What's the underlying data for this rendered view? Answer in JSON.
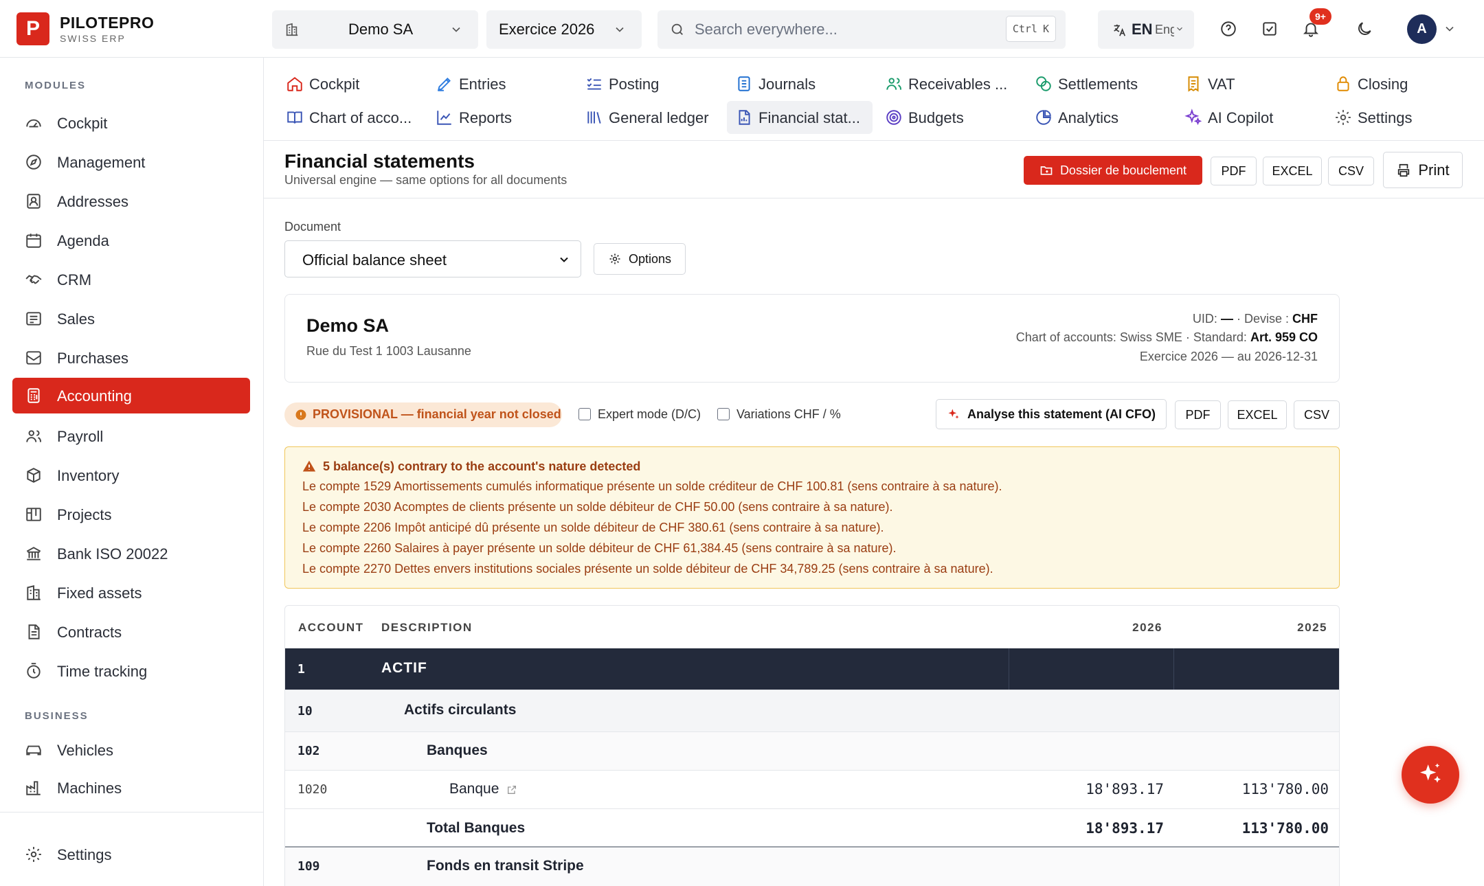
{
  "brand": {
    "logo_letter": "P",
    "name": "PILOTEPRO",
    "subtitle": "SWISS ERP",
    "color": "#d9281c"
  },
  "topbar": {
    "company": "Demo SA",
    "fiscal_year": "Exercice 2026",
    "search_placeholder": "Search everywhere...",
    "shortcut_key1": "Ctrl",
    "shortcut_key2": "K",
    "language_code": "EN",
    "language_name": "Eng",
    "notifications_badge": "9+",
    "avatar_initial": "A"
  },
  "sidebar": {
    "modules_title": "MODULES",
    "modules": [
      {
        "label": "Cockpit",
        "icon": "gauge-icon"
      },
      {
        "label": "Management",
        "icon": "compass-icon"
      },
      {
        "label": "Addresses",
        "icon": "contact-book-icon"
      },
      {
        "label": "Agenda",
        "icon": "calendar-icon"
      },
      {
        "label": "CRM",
        "icon": "handshake-icon"
      },
      {
        "label": "Sales",
        "icon": "receipt-icon"
      },
      {
        "label": "Purchases",
        "icon": "inbox-icon"
      },
      {
        "label": "Accounting",
        "icon": "calculator-icon",
        "active": true
      },
      {
        "label": "Payroll",
        "icon": "users-icon"
      },
      {
        "label": "Inventory",
        "icon": "box-icon"
      },
      {
        "label": "Projects",
        "icon": "kanban-icon"
      },
      {
        "label": "Bank ISO 20022",
        "icon": "bank-icon"
      },
      {
        "label": "Fixed assets",
        "icon": "building-icon"
      },
      {
        "label": "Contracts",
        "icon": "document-icon"
      },
      {
        "label": "Time tracking",
        "icon": "stopwatch-icon"
      }
    ],
    "business_title": "BUSINESS",
    "business": [
      {
        "label": "Vehicles",
        "icon": "car-icon"
      },
      {
        "label": "Machines",
        "icon": "factory-icon"
      }
    ],
    "settings_label": "Settings"
  },
  "modules_nav": [
    {
      "label": "Cockpit",
      "icon": "home-icon"
    },
    {
      "label": "Entries",
      "icon": "pencil-icon"
    },
    {
      "label": "Posting",
      "icon": "list-check-icon"
    },
    {
      "label": "Journals",
      "icon": "book-list-icon"
    },
    {
      "label": "Receivables ...",
      "icon": "users-icon"
    },
    {
      "label": "Settlements",
      "icon": "coins-icon"
    },
    {
      "label": "VAT",
      "icon": "receipt-icon"
    },
    {
      "label": "Closing",
      "icon": "lock-icon"
    },
    {
      "label": "Chart of acco...",
      "icon": "open-book-icon"
    },
    {
      "label": "Reports",
      "icon": "line-chart-icon"
    },
    {
      "label": "General ledger",
      "icon": "library-icon"
    },
    {
      "label": "Financial stat...",
      "icon": "file-chart-icon",
      "active": true
    },
    {
      "label": "Budgets",
      "icon": "target-icon"
    },
    {
      "label": "Analytics",
      "icon": "pie-icon"
    },
    {
      "label": "AI Copilot",
      "icon": "sparkles-icon"
    },
    {
      "label": "Settings",
      "icon": "gear-icon"
    }
  ],
  "page": {
    "title": "Financial statements",
    "subtitle": "Universal engine — same options for all documents",
    "dossier_button": "Dossier de bouclement",
    "pdf": "PDF",
    "excel": "EXCEL",
    "csv": "CSV",
    "print": "Print"
  },
  "document": {
    "label": "Document",
    "selected": "Official balance sheet",
    "options_button": "Options"
  },
  "company_card": {
    "name": "Demo SA",
    "address": "Rue du Test 1 1003 Lausanne",
    "uid_label": "UID:",
    "uid_value": "—",
    "currency_label": "· Devise :",
    "currency_value": "CHF",
    "chart_label": "Chart of accounts: Swiss SME · Standard:",
    "standard_value": "Art. 959 CO",
    "period": "Exercice 2026 — au 2026-12-31"
  },
  "toolbar": {
    "provisional": "PROVISIONAL — financial year not closed",
    "expert_mode": "Expert mode (D/C)",
    "variations": "Variations CHF / %",
    "analyse_button": "Analyse this statement (AI CFO)",
    "pdf": "PDF",
    "excel": "EXCEL",
    "csv": "CSV"
  },
  "warning": {
    "title": "5 balance(s) contrary to the account's nature detected",
    "lines": [
      "Le compte 1529 Amortissements cumulés informatique présente un solde créditeur de CHF 100.81 (sens contraire à sa nature).",
      "Le compte 2030 Acomptes de clients présente un solde débiteur de CHF 50.00 (sens contraire à sa nature).",
      "Le compte 2206 Impôt anticipé dû présente un solde débiteur de CHF 380.61 (sens contraire à sa nature).",
      "Le compte 2260 Salaires à payer présente un solde débiteur de CHF 61,384.45 (sens contraire à sa nature).",
      "Le compte 2270 Dettes envers institutions sociales présente un solde débiteur de CHF 34,789.25 (sens contraire à sa nature)."
    ]
  },
  "table": {
    "headers": {
      "account": "ACCOUNT",
      "description": "DESCRIPTION",
      "y1": "2026",
      "y2": "2025"
    },
    "rows": [
      {
        "account": "1",
        "description": "ACTIF",
        "v2026": "",
        "v2025": ""
      },
      {
        "account": "10",
        "description": "Actifs circulants",
        "v2026": "",
        "v2025": ""
      },
      {
        "account": "102",
        "description": "Banques",
        "v2026": "",
        "v2025": ""
      },
      {
        "account": "1020",
        "description": "Banque",
        "v2026": "18'893.17",
        "v2025": "113'780.00"
      },
      {
        "account": "",
        "description": "Total Banques",
        "v2026": "18'893.17",
        "v2025": "113'780.00"
      },
      {
        "account": "109",
        "description": "Fonds en transit Stripe",
        "v2026": "",
        "v2025": ""
      }
    ]
  }
}
